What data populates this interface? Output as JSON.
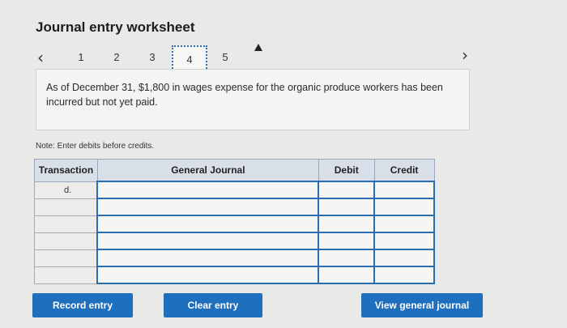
{
  "title": "Journal entry worksheet",
  "pager": {
    "prev_icon": "chevron-left-icon",
    "next_icon": "chevron-right-icon",
    "pages": [
      "1",
      "2",
      "3",
      "4",
      "5"
    ],
    "active_page": "4"
  },
  "prompt": "As of December 31, $1,800 in wages expense for the organic produce workers has been incurred but not yet paid.",
  "note": "Note: Enter debits before credits.",
  "table": {
    "headers": [
      "Transaction",
      "General Journal",
      "Debit",
      "Credit"
    ],
    "rows": [
      {
        "transaction": "d."
      },
      {
        "transaction": ""
      },
      {
        "transaction": ""
      },
      {
        "transaction": ""
      },
      {
        "transaction": ""
      },
      {
        "transaction": ""
      }
    ]
  },
  "buttons": {
    "record": "Record entry",
    "clear": "Clear entry",
    "view": "View general journal"
  },
  "colors": {
    "accent": "#1f6fbf",
    "header_bg": "#d9dfe8"
  }
}
